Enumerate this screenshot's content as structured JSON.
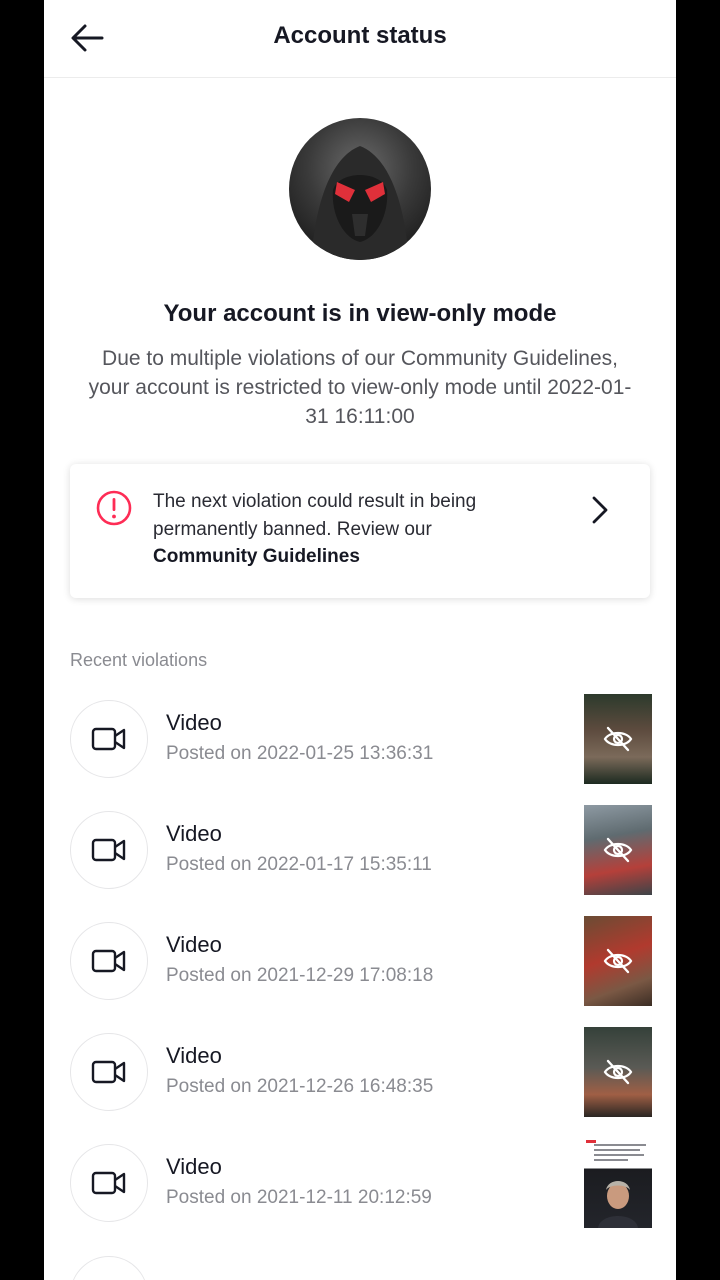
{
  "header": {
    "title": "Account status",
    "back_icon": "arrow-left-icon"
  },
  "status": {
    "title": "Your account is in view-only mode",
    "description": "Due to multiple violations of our Community Guidelines, your account is restricted to view-only mode until 2022-01-31 16:11:00"
  },
  "warning": {
    "text": "The next violation could result in being permanently banned. Review our",
    "link": "Community Guidelines",
    "icon": "alert-circle-icon",
    "accent_color": "#fe2c55"
  },
  "violations": {
    "section_label": "Recent violations",
    "items": [
      {
        "type": "Video",
        "date": "Posted on 2022-01-25 13:36:31",
        "hidden": true
      },
      {
        "type": "Video",
        "date": "Posted on 2022-01-17 15:35:11",
        "hidden": true
      },
      {
        "type": "Video",
        "date": "Posted on 2021-12-29 17:08:18",
        "hidden": true
      },
      {
        "type": "Video",
        "date": "Posted on 2021-12-26 16:48:35",
        "hidden": true
      },
      {
        "type": "Video",
        "date": "Posted on 2021-12-11 20:12:59",
        "hidden": false
      }
    ]
  }
}
